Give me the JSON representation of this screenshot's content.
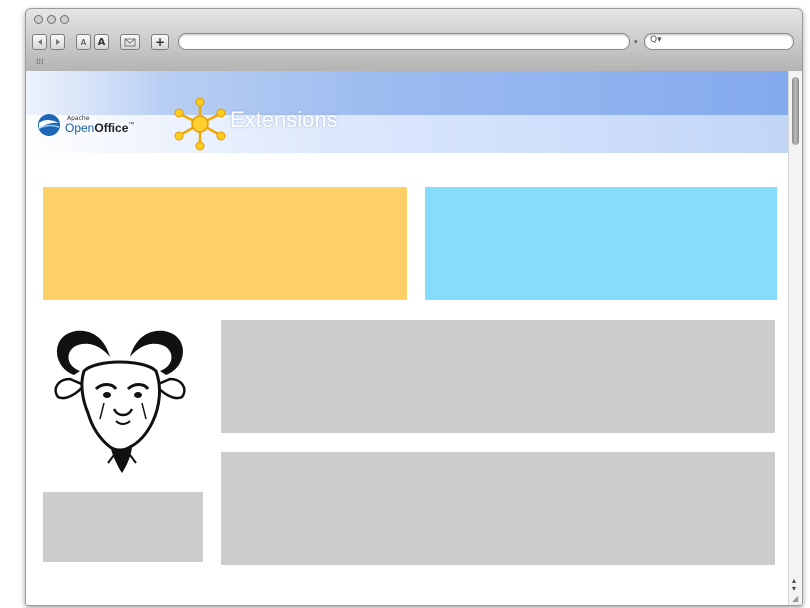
{
  "toolbar": {
    "smaller_text_label": "A",
    "larger_text_label": "A",
    "add_label": "+"
  },
  "search": {
    "icon_glyph": "Q▾"
  },
  "bookmarks_bar": {
    "label": "⁞⁞⁞"
  },
  "banner": {
    "brand_small": "Apache",
    "brand_open": "Open",
    "brand_office": "Office",
    "trademark": "™",
    "title": "Extensions"
  },
  "colors": {
    "panel_orange": "#ffd066",
    "panel_blue": "#86dcfd",
    "placeholder_gray": "#cccccc"
  },
  "icons": [
    "back-arrow-icon",
    "forward-arrow-icon",
    "bookmark-icon",
    "sun-cluster-icon",
    "openoffice-gull-icon",
    "gnu-head-icon",
    "search-icon"
  ]
}
